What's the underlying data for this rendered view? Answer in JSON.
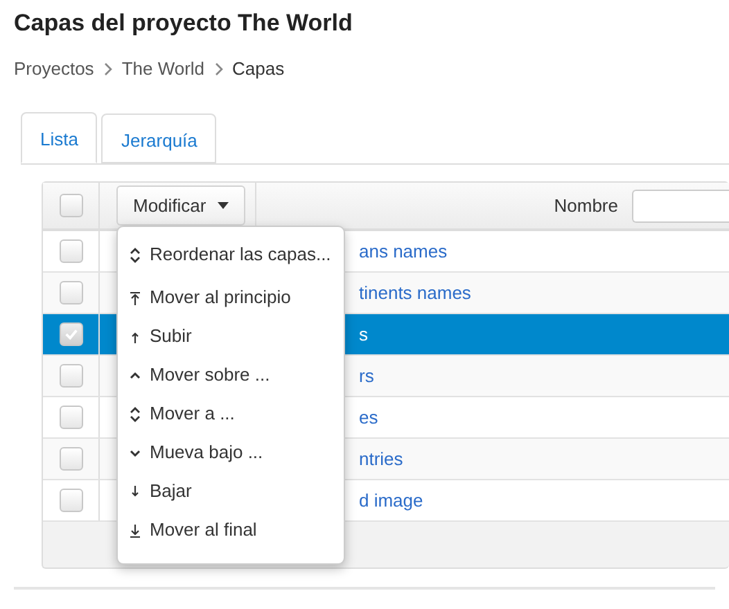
{
  "page_title": "Capas del proyecto The World",
  "breadcrumb": [
    {
      "label": "Proyectos"
    },
    {
      "label": "The World"
    },
    {
      "label": "Capas"
    }
  ],
  "tabs": [
    {
      "label": "Lista",
      "selected": true
    },
    {
      "label": "Jerarquía",
      "selected": false
    }
  ],
  "table": {
    "header_checked": false,
    "action_button": "Modificar",
    "filter_label": "Nombre",
    "rows": [
      {
        "name": "ans names",
        "checked": false,
        "selected": false
      },
      {
        "name": "tinents names",
        "checked": false,
        "selected": false
      },
      {
        "name": "s",
        "checked": true,
        "selected": true
      },
      {
        "name": "rs",
        "checked": false,
        "selected": false
      },
      {
        "name": "es",
        "checked": false,
        "selected": false
      },
      {
        "name": "ntries",
        "checked": false,
        "selected": false
      },
      {
        "name": "d image",
        "checked": false,
        "selected": false
      }
    ]
  },
  "menu": {
    "items": [
      {
        "label": "Reordenar las capas...",
        "kind": "updown"
      },
      {
        "label": "Mover al principio",
        "kind": "top"
      },
      {
        "label": "Subir",
        "kind": "up"
      },
      {
        "label": "Mover sobre ...",
        "kind": "above"
      },
      {
        "label": "Mover a ...",
        "kind": "updown"
      },
      {
        "label": "Mueva bajo ...",
        "kind": "below"
      },
      {
        "label": "Bajar",
        "kind": "down"
      },
      {
        "label": "Mover al final",
        "kind": "bottom"
      }
    ]
  }
}
